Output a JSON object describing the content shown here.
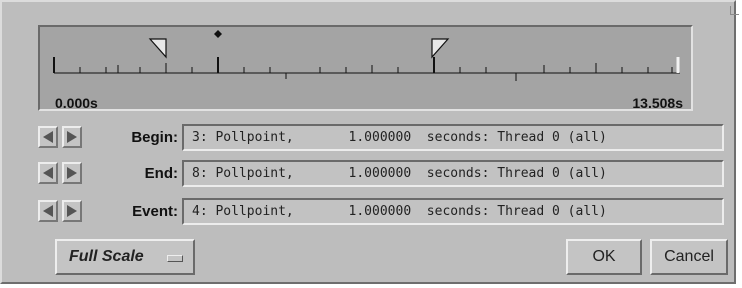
{
  "timeline": {
    "start_label": "0.000s",
    "end_label": "13.508s",
    "icons": [
      "triangle-marker",
      "diamond-marker"
    ]
  },
  "rows": {
    "begin": {
      "label": "Begin:",
      "value": "3: Pollpoint,       1.000000  seconds: Thread 0 (all)"
    },
    "end": {
      "label": "End:",
      "value": "8: Pollpoint,       1.000000  seconds: Thread 0 (all)"
    },
    "event": {
      "label": "Event:",
      "value": "4: Pollpoint,       1.000000  seconds: Thread 0 (all)"
    }
  },
  "buttons": {
    "full_scale": "Full Scale",
    "ok": "OK",
    "cancel": "Cancel"
  }
}
